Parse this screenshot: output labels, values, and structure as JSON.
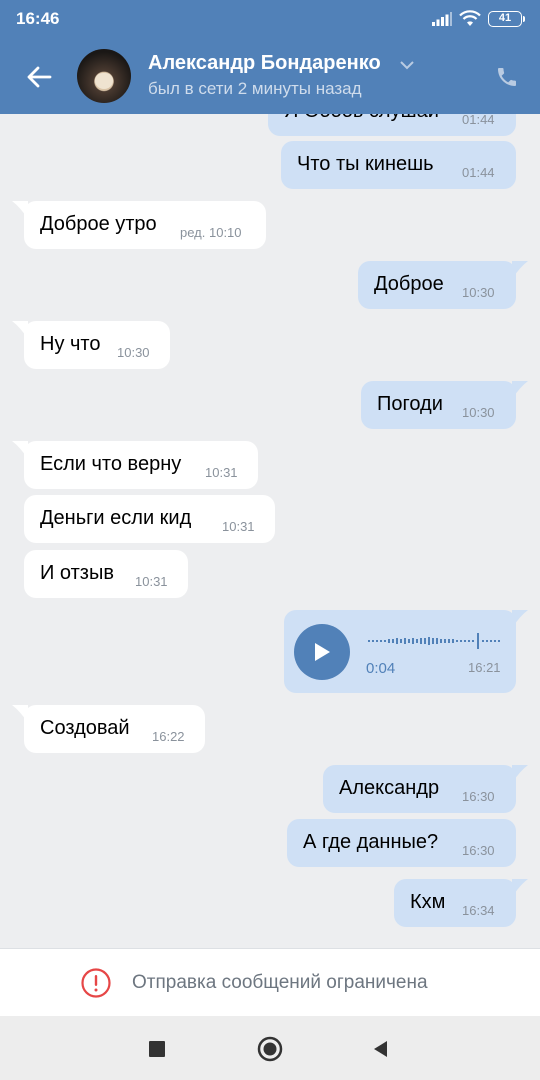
{
  "status_bar": {
    "time": "16:46",
    "battery": "41"
  },
  "header": {
    "name": "Александр Бондаренко",
    "status": "был в сети 2 минуты назад",
    "icons": {
      "back": "arrow-left-icon",
      "call": "phone-icon",
      "expand": "chevron-down-icon"
    }
  },
  "colors": {
    "header": "#5181b8",
    "outgoing": "#cfe0f5",
    "incoming": "#ffffff",
    "background": "#edeef0",
    "alert": "#e64646"
  },
  "messages": [
    {
      "dir": "out",
      "text": "Я Ооооь слушаи",
      "time": "01:44"
    },
    {
      "dir": "out",
      "text": "Что ты кинешь",
      "time": "01:44"
    },
    {
      "dir": "in",
      "text": "Доброе утро",
      "time": "ред. 10:10"
    },
    {
      "dir": "out",
      "text": "Доброе",
      "time": "10:30"
    },
    {
      "dir": "in",
      "text": "Ну что",
      "time": "10:30"
    },
    {
      "dir": "out",
      "text": "Погоди",
      "time": "10:30"
    },
    {
      "dir": "in",
      "text": "Если что верну",
      "time": "10:31"
    },
    {
      "dir": "in",
      "text": "Деньги если кид",
      "time": "10:31"
    },
    {
      "dir": "in",
      "text": "И отзыв",
      "time": "10:31"
    },
    {
      "dir": "out",
      "type": "voice",
      "duration": "0:04",
      "time": "16:21"
    },
    {
      "dir": "in",
      "text": "Создовай",
      "time": "16:22"
    },
    {
      "dir": "out",
      "text": "Александр",
      "time": "16:30"
    },
    {
      "dir": "out",
      "text": "А где данные?",
      "time": "16:30"
    },
    {
      "dir": "out",
      "text": "Кхм",
      "time": "16:34"
    }
  ],
  "restriction": {
    "text": "Отправка сообщений ограничена",
    "icon": "exclamation-circle-icon"
  },
  "nav": {
    "icons": [
      "square-recents-icon",
      "circle-home-icon",
      "triangle-back-icon"
    ]
  }
}
